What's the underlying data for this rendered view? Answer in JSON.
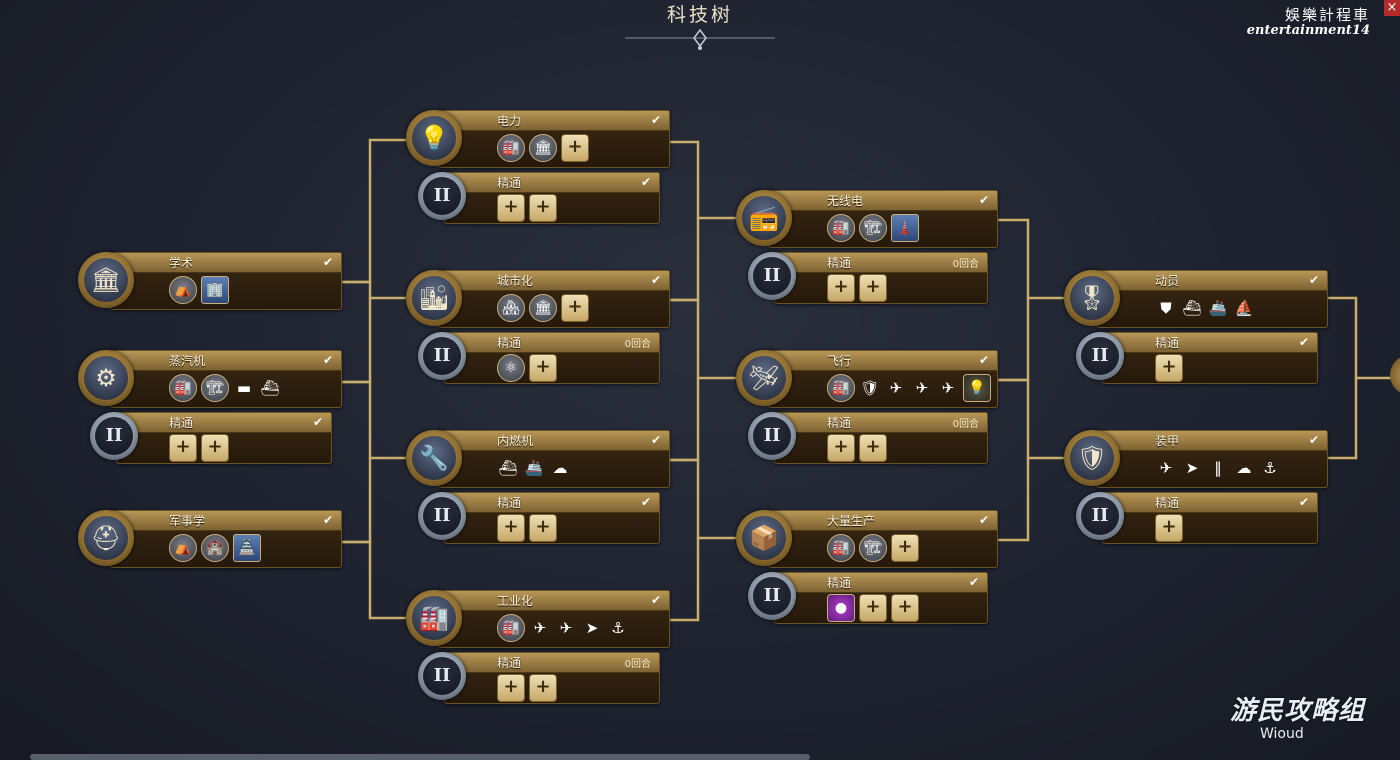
{
  "screen": {
    "title": "科技树",
    "close_label": "×",
    "watermark_line1": "娛樂計程車",
    "watermark_line2": "entertainment14",
    "brand_main": "游民攻略组",
    "brand_sub": "Wioud"
  },
  "techs": {
    "xueshu": {
      "name": "学术",
      "check": "✔",
      "icon": "🏛",
      "unlocks": [
        {
          "kind": "circle",
          "glyph": "⛺"
        },
        {
          "kind": "sq",
          "glyph": "🏢"
        }
      ]
    },
    "zhengqi": {
      "name": "蒸汽机",
      "check": "✔",
      "icon": "⚙",
      "unlocks": [
        {
          "kind": "circle",
          "glyph": "🏭"
        },
        {
          "kind": "circle",
          "glyph": "🏗"
        },
        {
          "kind": "glyph",
          "glyph": "▬"
        },
        {
          "kind": "glyph",
          "glyph": "⛴"
        }
      ]
    },
    "zhengqi_m": {
      "name": "精通",
      "check": "✔",
      "turns": "",
      "unlocks": [
        {
          "kind": "plus",
          "glyph": "+"
        },
        {
          "kind": "plus",
          "glyph": "+"
        }
      ]
    },
    "junshi": {
      "name": "军事学",
      "check": "✔",
      "icon": "⛑",
      "unlocks": [
        {
          "kind": "circle",
          "glyph": "⛺"
        },
        {
          "kind": "circle",
          "glyph": "🏰"
        },
        {
          "kind": "sq",
          "glyph": "🏯"
        }
      ]
    },
    "dianli": {
      "name": "电力",
      "check": "✔",
      "icon": "💡",
      "unlocks": [
        {
          "kind": "circle",
          "glyph": "🏭"
        },
        {
          "kind": "circle",
          "glyph": "🏛"
        },
        {
          "kind": "plus",
          "glyph": "+"
        }
      ]
    },
    "dianli_m": {
      "name": "精通",
      "check": "✔",
      "turns": "",
      "unlocks": [
        {
          "kind": "plus",
          "glyph": "+"
        },
        {
          "kind": "plus",
          "glyph": "+"
        }
      ]
    },
    "chengshi": {
      "name": "城市化",
      "check": "✔",
      "icon": "🏙",
      "unlocks": [
        {
          "kind": "circle",
          "glyph": "🏘"
        },
        {
          "kind": "circle",
          "glyph": "🏛"
        },
        {
          "kind": "plus",
          "glyph": "+"
        }
      ]
    },
    "chengshi_m": {
      "name": "精通",
      "check": "",
      "turns": "0回合",
      "unlocks": [
        {
          "kind": "circle",
          "glyph": "⚛"
        },
        {
          "kind": "plus",
          "glyph": "+"
        }
      ]
    },
    "neiran": {
      "name": "内燃机",
      "check": "✔",
      "icon": "🔧",
      "unlocks": [
        {
          "kind": "glyph",
          "glyph": "⛴"
        },
        {
          "kind": "glyph",
          "glyph": "🚢"
        },
        {
          "kind": "glyph",
          "glyph": "☁"
        }
      ]
    },
    "neiran_m": {
      "name": "精通",
      "check": "✔",
      "turns": "",
      "unlocks": [
        {
          "kind": "plus",
          "glyph": "+"
        },
        {
          "kind": "plus",
          "glyph": "+"
        }
      ]
    },
    "gongye": {
      "name": "工业化",
      "check": "✔",
      "icon": "🏭",
      "unlocks": [
        {
          "kind": "circle",
          "glyph": "🏭"
        },
        {
          "kind": "glyph",
          "glyph": "✈"
        },
        {
          "kind": "glyph",
          "glyph": "✈"
        },
        {
          "kind": "glyph",
          "glyph": "➤"
        },
        {
          "kind": "glyph",
          "glyph": "⚓"
        }
      ]
    },
    "gongye_m": {
      "name": "精通",
      "check": "",
      "turns": "0回合",
      "unlocks": [
        {
          "kind": "plus",
          "glyph": "+"
        },
        {
          "kind": "plus",
          "glyph": "+"
        }
      ]
    },
    "wuxian": {
      "name": "无线电",
      "check": "✔",
      "icon": "📻",
      "unlocks": [
        {
          "kind": "circle",
          "glyph": "🏭"
        },
        {
          "kind": "circle",
          "glyph": "🏗"
        },
        {
          "kind": "sq",
          "glyph": "🗼"
        }
      ]
    },
    "wuxian_m": {
      "name": "精通",
      "check": "",
      "turns": "0回合",
      "unlocks": [
        {
          "kind": "plus",
          "glyph": "+"
        },
        {
          "kind": "plus",
          "glyph": "+"
        }
      ]
    },
    "feixing": {
      "name": "飞行",
      "check": "✔",
      "icon": "🛩",
      "unlocks": [
        {
          "kind": "circle",
          "glyph": "🏭"
        },
        {
          "kind": "glyph",
          "glyph": "🛡"
        },
        {
          "kind": "glyph",
          "glyph": "✈"
        },
        {
          "kind": "glyph",
          "glyph": "✈"
        },
        {
          "kind": "glyph",
          "glyph": "✈"
        },
        {
          "kind": "bulb",
          "glyph": "💡"
        }
      ]
    },
    "feixing_m": {
      "name": "精通",
      "check": "",
      "turns": "0回合",
      "unlocks": [
        {
          "kind": "plus",
          "glyph": "+"
        },
        {
          "kind": "plus",
          "glyph": "+"
        }
      ]
    },
    "daliang": {
      "name": "大量生产",
      "check": "✔",
      "icon": "📦",
      "unlocks": [
        {
          "kind": "circle",
          "glyph": "🏭"
        },
        {
          "kind": "circle",
          "glyph": "🏗"
        },
        {
          "kind": "plus",
          "glyph": "+"
        }
      ]
    },
    "daliang_m": {
      "name": "精通",
      "check": "✔",
      "turns": "",
      "unlocks": [
        {
          "kind": "purple",
          "glyph": "●"
        },
        {
          "kind": "plus",
          "glyph": "+"
        },
        {
          "kind": "plus",
          "glyph": "+"
        }
      ]
    },
    "dongyuan": {
      "name": "动员",
      "check": "✔",
      "icon": "🎖",
      "unlocks": [
        {
          "kind": "glyph",
          "glyph": "⛊"
        },
        {
          "kind": "glyph",
          "glyph": "⛴"
        },
        {
          "kind": "glyph",
          "glyph": "🚢"
        },
        {
          "kind": "glyph",
          "glyph": "⛵"
        }
      ]
    },
    "dongyuan_m": {
      "name": "精通",
      "check": "✔",
      "turns": "",
      "unlocks": [
        {
          "kind": "plus",
          "glyph": "+"
        }
      ]
    },
    "zhuangjia": {
      "name": "装甲",
      "check": "✔",
      "icon": "🛡",
      "unlocks": [
        {
          "kind": "glyph",
          "glyph": "✈"
        },
        {
          "kind": "glyph",
          "glyph": "➤"
        },
        {
          "kind": "glyph",
          "glyph": "‖"
        },
        {
          "kind": "glyph",
          "glyph": "☁"
        },
        {
          "kind": "glyph",
          "glyph": "⚓"
        }
      ]
    },
    "zhuangjia_m": {
      "name": "精通",
      "check": "✔",
      "turns": "",
      "unlocks": [
        {
          "kind": "plus",
          "glyph": "+"
        }
      ]
    }
  },
  "mastery_badge": "II"
}
